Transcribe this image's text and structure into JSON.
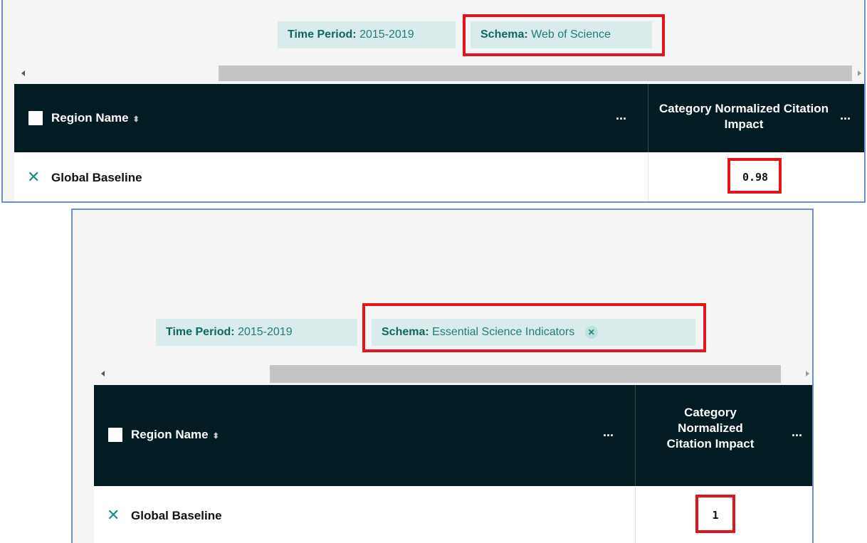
{
  "colors": {
    "panel_border": "#6e8fcf",
    "header_bg": "#031b22",
    "chip_bg": "#d9ebea",
    "chip_text": "#1f7c7a",
    "highlight": "#e3141c"
  },
  "panels": [
    {
      "filters": {
        "time_period": {
          "key": "Time Period:",
          "value": "2015-2019"
        },
        "schema": {
          "key": "Schema:",
          "value": "Web of Science"
        }
      },
      "table": {
        "column_region": "Region Name",
        "column_metric": "Category Normalized Citation Impact",
        "menu_label": "...",
        "rows": [
          {
            "name": "Global Baseline",
            "value": "0.98"
          }
        ]
      }
    },
    {
      "filters": {
        "time_period": {
          "key": "Time Period:",
          "value": "2015-2019"
        },
        "schema": {
          "key": "Schema:",
          "value": "Essential Science Indicators"
        }
      },
      "table": {
        "column_region": "Region Name",
        "column_metric_lines": [
          "Category",
          "Normalized",
          "Citation Impact"
        ],
        "menu_label": "...",
        "rows": [
          {
            "name": "Global Baseline",
            "value": "1"
          }
        ]
      }
    }
  ],
  "icons": {
    "sort": "sort-icon",
    "remove_row": "close-x-icon",
    "remove_filter": "close-circle-icon",
    "checkbox": "checkbox-icon"
  }
}
